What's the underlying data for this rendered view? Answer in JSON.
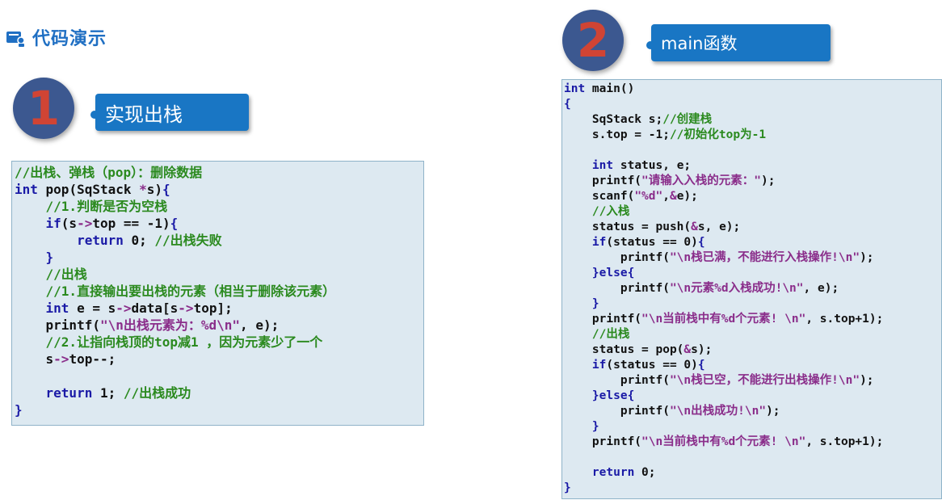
{
  "header": {
    "title": "代码演示",
    "icon": "presenter-icon"
  },
  "section1": {
    "number": "1",
    "label": "实现出栈"
  },
  "section2": {
    "number": "2",
    "label": "main函数"
  },
  "colors": {
    "accent": "#1976c4",
    "circle": "#3c5890",
    "number": "#d04434",
    "code_bg": "#dde9f1",
    "keyword": "#1a1aa6",
    "comment": "#2b8a1f",
    "string": "#8a2d8a"
  },
  "code1": [
    [
      [
        "cm",
        "//出栈、弹栈（pop）：删除数据"
      ]
    ],
    [
      [
        "kw",
        "int"
      ],
      [
        "tx",
        " pop(SqStack "
      ],
      [
        "st",
        "*"
      ],
      [
        "tx",
        "s)"
      ],
      [
        "br",
        "{"
      ]
    ],
    [
      [
        "tx",
        "    "
      ],
      [
        "cm",
        "//1.判断是否为空栈"
      ]
    ],
    [
      [
        "tx",
        "    "
      ],
      [
        "kw",
        "if"
      ],
      [
        "tx",
        "(s"
      ],
      [
        "st",
        "->"
      ],
      [
        "tx",
        "top == -1)"
      ],
      [
        "br",
        "{"
      ]
    ],
    [
      [
        "tx",
        "        "
      ],
      [
        "kw",
        "return"
      ],
      [
        "tx",
        " 0; "
      ],
      [
        "cm",
        "//出栈失败"
      ]
    ],
    [
      [
        "tx",
        "    "
      ],
      [
        "br",
        "}"
      ]
    ],
    [
      [
        "tx",
        "    "
      ],
      [
        "cm",
        "//出栈"
      ]
    ],
    [
      [
        "tx",
        "    "
      ],
      [
        "cm",
        "//1.直接输出要出栈的元素（相当于删除该元素）"
      ]
    ],
    [
      [
        "tx",
        "    "
      ],
      [
        "kw",
        "int"
      ],
      [
        "tx",
        " e = s"
      ],
      [
        "st",
        "->"
      ],
      [
        "tx",
        "data[s"
      ],
      [
        "st",
        "->"
      ],
      [
        "tx",
        "top];"
      ]
    ],
    [
      [
        "tx",
        "    printf("
      ],
      [
        "st",
        "\"\\n出栈元素为：%d\\n\""
      ],
      [
        "tx",
        ", e);"
      ]
    ],
    [
      [
        "tx",
        "    "
      ],
      [
        "cm",
        "//2.让指向栈顶的top减1 ，因为元素少了一个"
      ]
    ],
    [
      [
        "tx",
        "    s"
      ],
      [
        "st",
        "->"
      ],
      [
        "tx",
        "top--;"
      ]
    ],
    [
      [
        "tx",
        ""
      ]
    ],
    [
      [
        "tx",
        "    "
      ],
      [
        "kw",
        "return"
      ],
      [
        "tx",
        " 1; "
      ],
      [
        "cm",
        "//出栈成功"
      ]
    ],
    [
      [
        "br",
        "}"
      ]
    ]
  ],
  "code2": [
    [
      [
        "kw",
        "int"
      ],
      [
        "tx",
        " main()"
      ]
    ],
    [
      [
        "br",
        "{"
      ]
    ],
    [
      [
        "tx",
        "    SqStack s;"
      ],
      [
        "cm",
        "//创建栈"
      ]
    ],
    [
      [
        "tx",
        "    s.top = -1;"
      ],
      [
        "cm",
        "//初始化top为-1"
      ]
    ],
    [
      [
        "tx",
        ""
      ]
    ],
    [
      [
        "tx",
        "    "
      ],
      [
        "kw",
        "int"
      ],
      [
        "tx",
        " status, e;"
      ]
    ],
    [
      [
        "tx",
        "    printf("
      ],
      [
        "st",
        "\"请输入入栈的元素：\""
      ],
      [
        "tx",
        ");"
      ]
    ],
    [
      [
        "tx",
        "    scanf("
      ],
      [
        "st",
        "\"%d\""
      ],
      [
        "tx",
        ","
      ],
      [
        "st",
        "&"
      ],
      [
        "tx",
        "e);"
      ]
    ],
    [
      [
        "tx",
        "    "
      ],
      [
        "cm",
        "//入栈"
      ]
    ],
    [
      [
        "tx",
        "    status = push("
      ],
      [
        "st",
        "&"
      ],
      [
        "tx",
        "s, e);"
      ]
    ],
    [
      [
        "tx",
        "    "
      ],
      [
        "kw",
        "if"
      ],
      [
        "tx",
        "(status == 0)"
      ],
      [
        "br",
        "{"
      ]
    ],
    [
      [
        "tx",
        "        printf("
      ],
      [
        "st",
        "\"\\n栈已满，不能进行入栈操作!\\n\""
      ],
      [
        "tx",
        ");"
      ]
    ],
    [
      [
        "tx",
        "    "
      ],
      [
        "br",
        "}"
      ],
      [
        "kw",
        "else"
      ],
      [
        "br",
        "{"
      ]
    ],
    [
      [
        "tx",
        "        printf("
      ],
      [
        "st",
        "\"\\n元素%d入栈成功!\\n\""
      ],
      [
        "tx",
        ", e);"
      ]
    ],
    [
      [
        "tx",
        "    "
      ],
      [
        "br",
        "}"
      ]
    ],
    [
      [
        "tx",
        "    printf("
      ],
      [
        "st",
        "\"\\n当前栈中有%d个元素! \\n\""
      ],
      [
        "tx",
        ", s.top+1);"
      ]
    ],
    [
      [
        "tx",
        "    "
      ],
      [
        "cm",
        "//出栈"
      ]
    ],
    [
      [
        "tx",
        "    status = pop("
      ],
      [
        "st",
        "&"
      ],
      [
        "tx",
        "s);"
      ]
    ],
    [
      [
        "tx",
        "    "
      ],
      [
        "kw",
        "if"
      ],
      [
        "tx",
        "(status == 0)"
      ],
      [
        "br",
        "{"
      ]
    ],
    [
      [
        "tx",
        "        printf("
      ],
      [
        "st",
        "\"\\n栈已空，不能进行出栈操作!\\n\""
      ],
      [
        "tx",
        ");"
      ]
    ],
    [
      [
        "tx",
        "    "
      ],
      [
        "br",
        "}"
      ],
      [
        "kw",
        "else"
      ],
      [
        "br",
        "{"
      ]
    ],
    [
      [
        "tx",
        "        printf("
      ],
      [
        "st",
        "\"\\n出栈成功!\\n\""
      ],
      [
        "tx",
        ");"
      ]
    ],
    [
      [
        "tx",
        "    "
      ],
      [
        "br",
        "}"
      ]
    ],
    [
      [
        "tx",
        "    printf("
      ],
      [
        "st",
        "\"\\n当前栈中有%d个元素! \\n\""
      ],
      [
        "tx",
        ", s.top+1);"
      ]
    ],
    [
      [
        "tx",
        ""
      ]
    ],
    [
      [
        "tx",
        "    "
      ],
      [
        "kw",
        "return"
      ],
      [
        "tx",
        " 0;"
      ]
    ],
    [
      [
        "br",
        "}"
      ]
    ]
  ]
}
